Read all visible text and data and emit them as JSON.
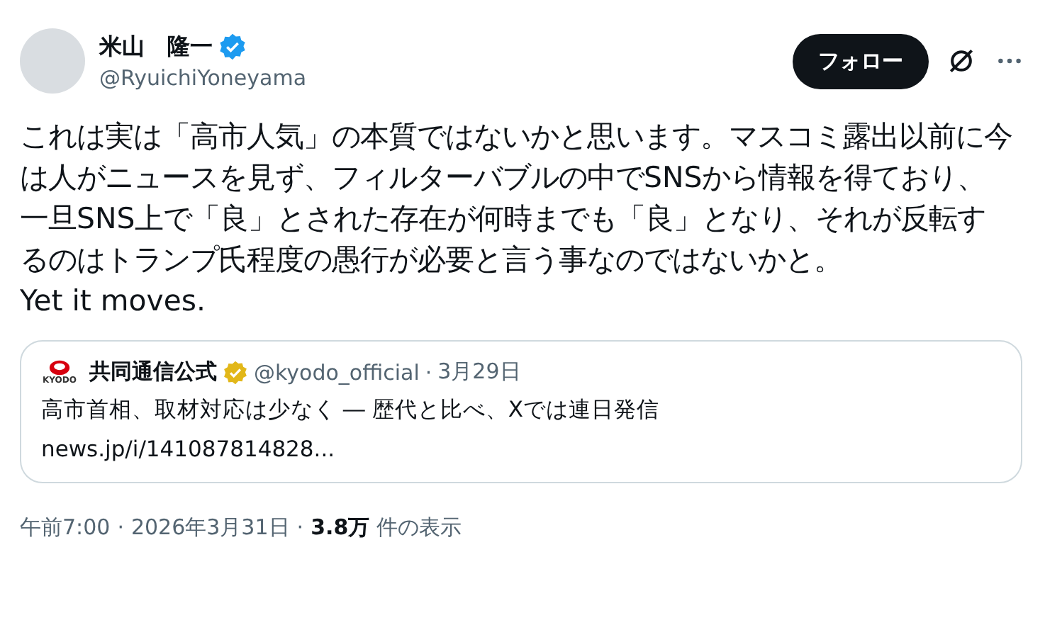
{
  "author": {
    "name": "米山　隆一",
    "verified": true,
    "handle": "@RyuichiYoneyama"
  },
  "follow_button": "フォロー",
  "body": "これは実は「高市人気」の本質ではないかと思います。マスコミ露出以前に今は人がニュースを見ず、フィルターバブルの中でSNSから情報を得ており、一旦SNS上で「良」とされた存在が何時までも「良」となり、それが反転するのはトランプ氏程度の愚行が必要と言う事なのではないかと。\nYet it moves.",
  "quote": {
    "logo_text": "KYODO",
    "name": "共同通信公式",
    "verified": true,
    "handle": "@kyodo_official",
    "separator": "·",
    "date": "3月29日",
    "text": "高市首相、取材対応は少なく ― 歴代と比べ、Xでは連日発信",
    "link": "news.jp/i/141087814828..."
  },
  "footer": {
    "time": "午前7:00",
    "separator": "·",
    "date": "2026年3月31日",
    "views": "3.8万",
    "views_label": "件の表示"
  }
}
